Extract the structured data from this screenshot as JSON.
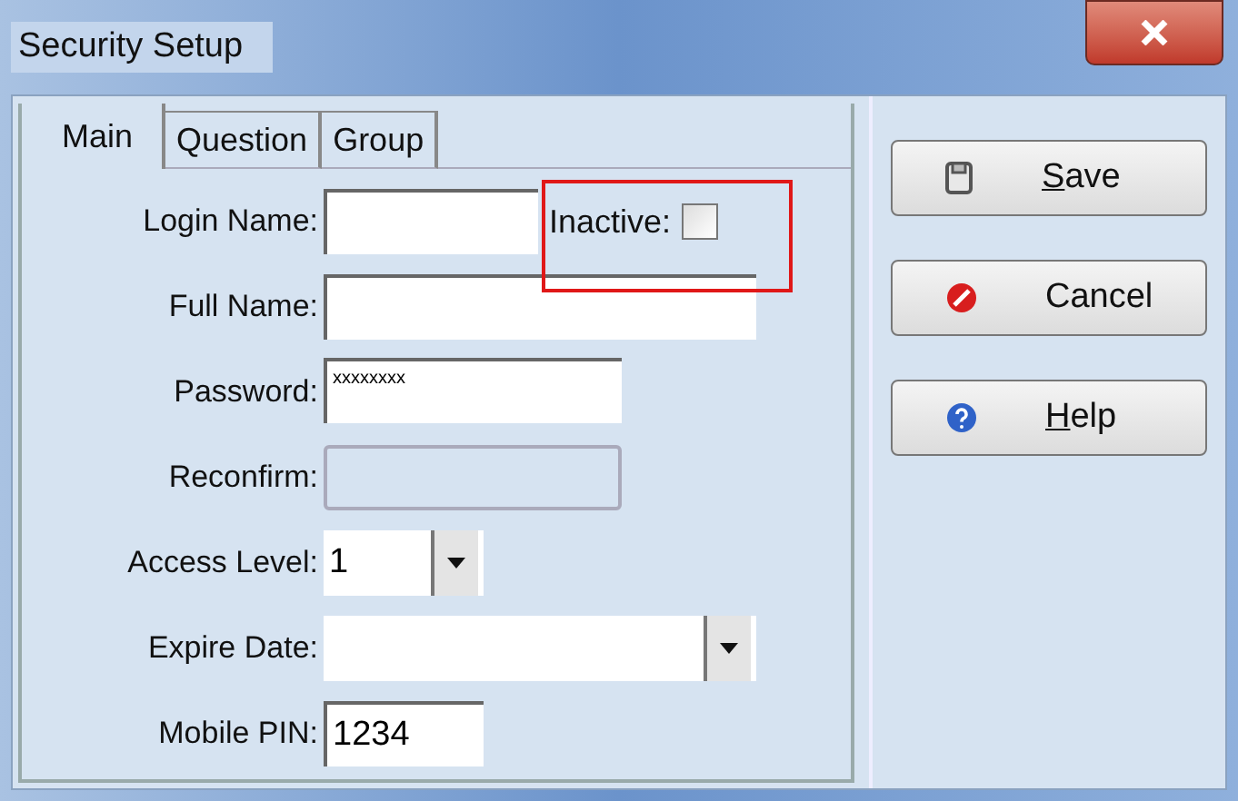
{
  "window": {
    "title": "Security Setup"
  },
  "tabs": [
    {
      "label": "Main",
      "selected": true
    },
    {
      "label": "Question",
      "selected": false
    },
    {
      "label": "Group",
      "selected": false
    }
  ],
  "fields": [
    {
      "kind": "text",
      "label": "Login Name:"
    },
    {
      "kind": "text",
      "label": "Full Name:"
    },
    {
      "kind": "text",
      "label": "Password:",
      "value": "xxxxxxxx"
    },
    {
      "kind": "disabled",
      "label": "Reconfirm:"
    },
    {
      "kind": "dropdown",
      "label": "Access Level:",
      "value": "1"
    },
    {
      "kind": "dropdown",
      "label": "Expire Date:"
    },
    {
      "kind": "text",
      "label": "Mobile PIN:",
      "value": "1234"
    }
  ],
  "inactive": {
    "label": "Inactive:",
    "checked": false,
    "highlighted": true
  },
  "buttons": [
    {
      "kind": "save",
      "label": "Save",
      "mnemonic": true
    },
    {
      "kind": "cancel",
      "label": "Cancel",
      "mnemonic": false
    },
    {
      "kind": "help",
      "label": "Help",
      "mnemonic": true
    }
  ]
}
